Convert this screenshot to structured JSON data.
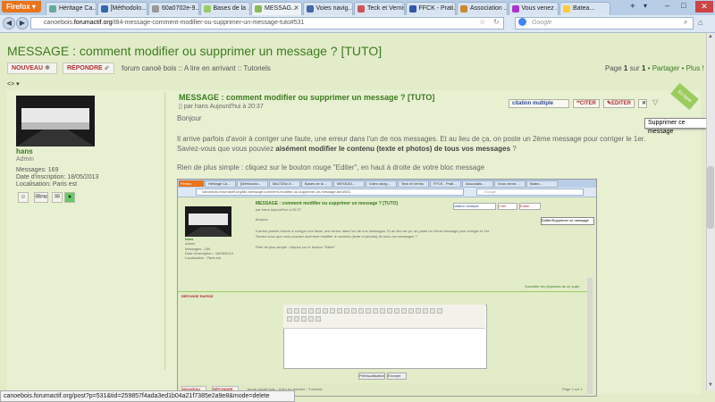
{
  "browser": {
    "menu_label": "Firefox",
    "tabs": [
      {
        "label": "Héritage Ca..."
      },
      {
        "label": "[Méthodolo..."
      },
      {
        "label": "60a0702e-9..."
      },
      {
        "label": "Bases de la ..."
      },
      {
        "label": "MESSAG...",
        "active": true
      },
      {
        "label": "Voies navig..."
      },
      {
        "label": "Teck et Vernis"
      },
      {
        "label": "FFCK - Prati..."
      },
      {
        "label": "Association ..."
      },
      {
        "label": "Vous venez ..."
      },
      {
        "label": "Batea..."
      }
    ],
    "url_domain": "canoebois.",
    "url_host": "forumactif.org",
    "url_path": "/t84-message-comment-modifier-ou-supprimer-un-message-tuto#531",
    "search_placeholder": "Google",
    "status_url": "canoebois.forumactif.org/post?p=531&tid=259857f4ada3ed1b04a21f7385e2a9e8&mode=delete"
  },
  "page": {
    "title": "MESSAGE : comment modifier ou supprimer un message ? [TUTO]",
    "new_button": "NOUVEAU",
    "reply_button": "RÉPONDRE",
    "breadcrumb": "forum canoë bois :: A lire en arrivant :: Tutoriels",
    "page_label": "Page",
    "page_current": "1",
    "page_sep": "sur",
    "page_total": "1",
    "share_label": "Partager",
    "more_label": "Plus !",
    "nav_arrows": "<> ▾"
  },
  "post": {
    "author": "hans",
    "rank": "Admin",
    "messages": "Messages: 169",
    "registered": "Date d'inscription: 18/05/2013",
    "location": "Localisation: Paris est",
    "title": "MESSAGE : comment modifier ou supprimer un message ? [TUTO]",
    "meta": "par hans Aujourd'hui à 20:37",
    "greeting": "Bonjour",
    "p1_line1": "Il arrive parfois d'avoir à corriger une faute, une erreur dans l'un de nos messages. Et au lieu de ça, on poste un 2ème message pour corriger le 1er.",
    "p1_line2_a": "Saviez-vous que vous pouviez ",
    "p1_line2_b": "aisément modifier le contenu (texte et photos) de tous vos messages",
    "p1_line2_c": " ?",
    "p2": "Rien de plus simple : cliquez sur le bouton rouge \"Editer\", en haut à droite de votre bloc message",
    "multiquote": "citation multiple",
    "quote": "CITER",
    "edit": "EDITER",
    "tooltip": "Supprimer ce message",
    "badge": "En ligne",
    "pm_label": "PM"
  },
  "embedded": {
    "menu_label": "Firefox",
    "tabs": [
      "Héritage Ca...",
      "[Méthodolo...",
      "MàJ7D0z-9...",
      "Bases de la ...",
      "MESSAG...",
      "Voies navig...",
      "Teck et Vernis",
      "FFCK - Prati...",
      "Associatio...",
      "Vous venez ...",
      "Batea..."
    ],
    "url": "canoebois.forumactif.org/t84-message-comment-modifier-ou-supprimer-un-message-tuto#531",
    "search": "Google",
    "post_title": "MESSAGE : comment modifier ou supprimer un message ? [TUTO]",
    "meta": "par hans Aujourd'hui à 20:37",
    "greeting": "Bonjour",
    "line1": "Il arrive parfois d'avoir à corriger une faute, une erreur dans l'un de nos messages. Et au lieu de ça, on poste un 2ème message pour corriger le 1er.",
    "line2": "Saviez-vous que vous pouviez aisément modifier le contenu (texte et photos) de tous vos messages ?",
    "line3": "Rien de plus simple : cliquez sur le bouton \"Editer\"",
    "author": "hans",
    "rank": "Admin",
    "info1": "Messages : 169",
    "info2": "Date d'inscription : 18/05/2013",
    "info3": "Localisation : Paris est",
    "multiquote": "citation multiple",
    "quote": "Citer",
    "edit": "Editer",
    "tooltip": "Editer/Supprimer ce message",
    "watch": "Surveiller les réponses de ce sujet",
    "quick_reply": "RÉPONSE RAPIDE",
    "preview_button": "Prévisualisation",
    "send_button": "Envoyer",
    "new_button": "NOUVEAU",
    "reply_button": "RÉPONDRE",
    "breadcrumb": "forum canoë bois :: A lire en arrivant :: Tutoriels",
    "pagination": "Page 1 sur 1"
  }
}
